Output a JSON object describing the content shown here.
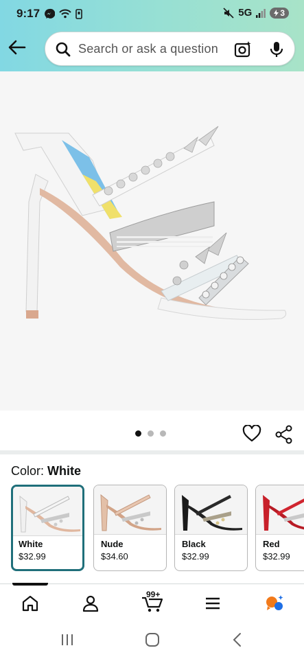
{
  "status_bar": {
    "time": "9:17",
    "network": "5G",
    "battery": "3"
  },
  "search": {
    "placeholder": "Search or ask a question"
  },
  "carousel": {
    "image_count": 3,
    "active_index": 0
  },
  "color_selector": {
    "label": "Color:",
    "selected": "White",
    "options": [
      {
        "name": "White",
        "price": "$32.99"
      },
      {
        "name": "Nude",
        "price": "$34.60"
      },
      {
        "name": "Black",
        "price": "$32.99"
      },
      {
        "name": "Red",
        "price": "$32.99"
      }
    ]
  },
  "bottom_nav": {
    "cart_count": "99+"
  },
  "colors": {
    "accent_teal": "#1f6f7a",
    "header_gradient_start": "#82d8e3",
    "header_gradient_end": "#a8e3c8"
  }
}
